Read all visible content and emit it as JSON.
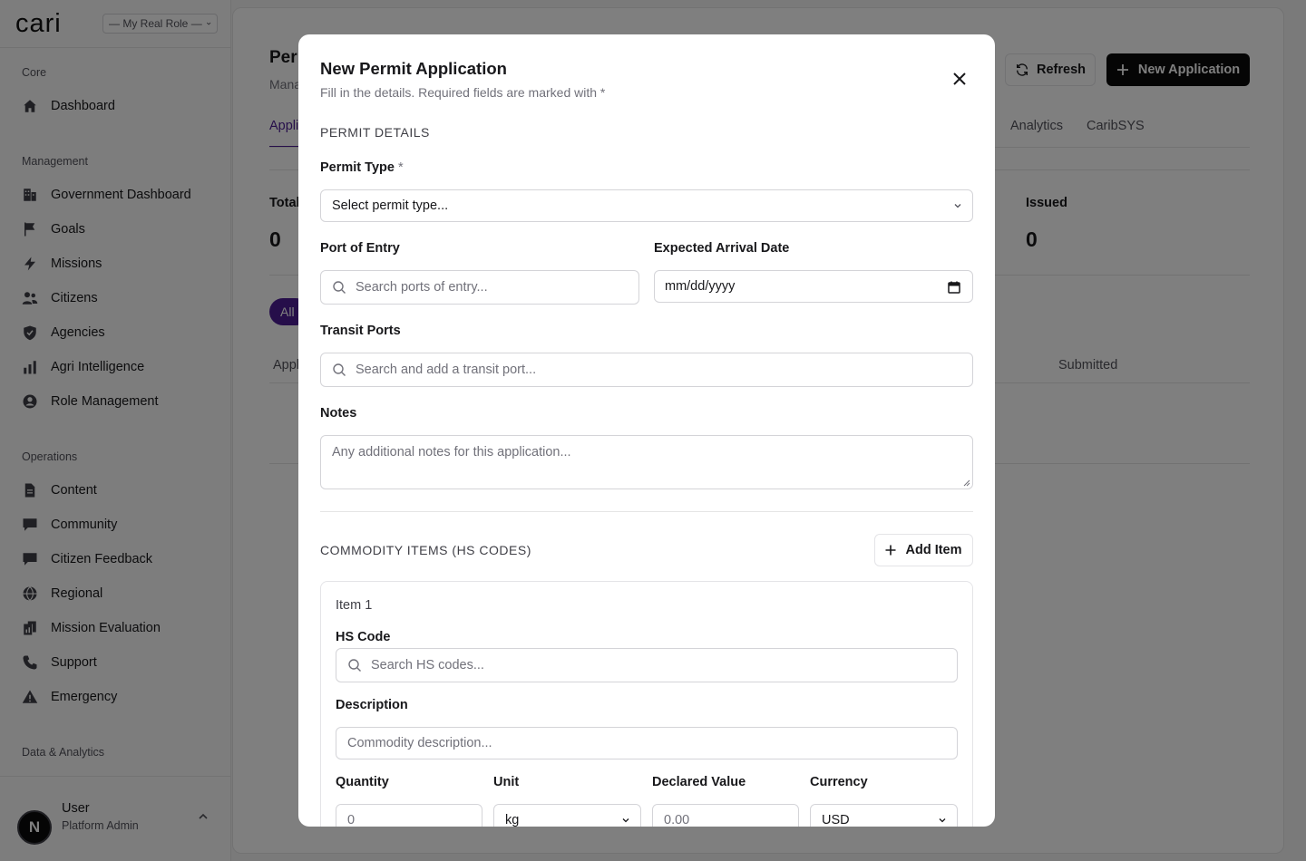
{
  "sidebar": {
    "logo": "cari",
    "role_select": "— My Real Role —",
    "groups": {
      "core": "Core",
      "management": "Management",
      "operations": "Operations",
      "data": "Data & Analytics"
    },
    "items": {
      "dashboard": "Dashboard",
      "gov_dashboard": "Government Dashboard",
      "goals": "Goals",
      "missions": "Missions",
      "citizens": "Citizens",
      "agencies": "Agencies",
      "agri": "Agri Intelligence",
      "roles": "Role Management",
      "content": "Content",
      "community": "Community",
      "feedback": "Citizen Feedback",
      "regional": "Regional",
      "evaluation": "Mission Evaluation",
      "support": "Support",
      "emergency": "Emergency"
    },
    "user": {
      "initial": "N",
      "name": "User",
      "role": "Platform Admin"
    }
  },
  "page": {
    "title": "Per",
    "subtitle": "Mana",
    "refresh": "Refresh",
    "new_application": "New Application",
    "tabs": {
      "applications": "Appli",
      "analytics": "Analytics",
      "caribsys": "CaribSYS"
    },
    "stats": {
      "total_label": "Total",
      "total_value": "0",
      "issued_label": "Issued",
      "issued_value": "0"
    },
    "filter_all": "All",
    "columns": {
      "app": "Appl",
      "submitted": "Submitted"
    }
  },
  "modal": {
    "title": "New Permit Application",
    "subtitle": "Fill in the details. Required fields are marked with *",
    "permit_section": "PERMIT DETAILS",
    "permit_type_label": "Permit Type",
    "required_mark": "*",
    "permit_type_value": "Select permit type...",
    "port_label": "Port of Entry",
    "port_placeholder": "Search ports of entry...",
    "arrival_label": "Expected Arrival Date",
    "arrival_value": "mm/dd/yyyy",
    "transit_label": "Transit Ports",
    "transit_placeholder": "Search and add a transit port...",
    "notes_label": "Notes",
    "notes_placeholder": "Any additional notes for this application...",
    "commodity_section": "COMMODITY ITEMS (HS CODES)",
    "add_item": "Add Item",
    "item": {
      "title": "Item 1",
      "hs_label": "HS Code",
      "hs_placeholder": "Search HS codes...",
      "desc_label": "Description",
      "desc_placeholder": "Commodity description...",
      "qty_label": "Quantity",
      "qty_placeholder": "0",
      "unit_label": "Unit",
      "unit_value": "kg",
      "value_label": "Declared Value",
      "value_placeholder": "0.00",
      "currency_label": "Currency",
      "currency_value": "USD"
    }
  },
  "colors": {
    "accent": "#4c1d95",
    "primary_button": "#0a0a0a",
    "overlay": "#000000"
  }
}
